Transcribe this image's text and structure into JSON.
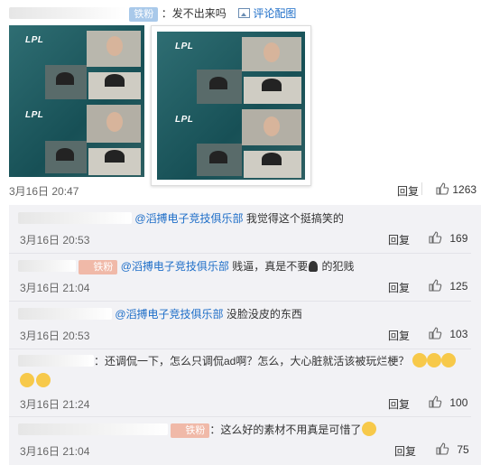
{
  "main_comment": {
    "badge": "铁粉",
    "text": "：发不出来吗",
    "view_image_link": "评论配图",
    "time": "3月16日 20:47",
    "reply_label": "回复",
    "likes": "1263"
  },
  "replies": [
    {
      "mention": "@滔搏电子竞技俱乐部",
      "text": " 我觉得这个挺搞笑的",
      "time": "3月16日 20:53",
      "reply_label": "回复",
      "likes": "169",
      "badge": ""
    },
    {
      "mention": "@滔搏电子竞技俱乐部",
      "text": " 贱逼，真是不要",
      "text_after": " 的犯贱",
      "time": "3月16日 21:04",
      "reply_label": "回复",
      "likes": "125",
      "badge": "铁粉"
    },
    {
      "mention": "@滔搏电子竞技俱乐部",
      "text": " 没脸没皮的东西",
      "time": "3月16日 20:53",
      "reply_label": "回复",
      "likes": "103",
      "badge": ""
    },
    {
      "mention": "",
      "text": "：还调侃一下，怎么只调侃ad啊？怎么，大心脏就活该被玩烂梗？",
      "time": "3月16日 21:24",
      "reply_label": "回复",
      "likes": "100",
      "badge": ""
    },
    {
      "mention": "",
      "text": "：这么好的素材不用真是可惜了",
      "time": "3月16日 21:04",
      "reply_label": "回复",
      "likes": "75",
      "badge": "铁粉"
    }
  ],
  "images": {
    "logo_text": "LPL"
  },
  "colors": {
    "link": "#1e6ec8",
    "reply_bg": "#f2f2f5",
    "badge_pink": "#f6c2c2"
  }
}
